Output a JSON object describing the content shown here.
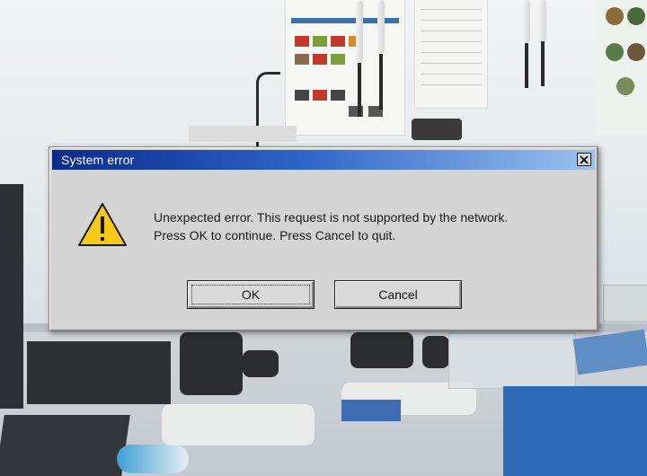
{
  "dialog": {
    "title": "System error",
    "close_icon": "close-icon",
    "icon": "warning-triangle-icon",
    "message_line1": "Unexpected error. This request is not supported by the network.",
    "message_line2": "Press OK to continue. Press Cancel to quit.",
    "ok_label": "OK",
    "cancel_label": "Cancel"
  },
  "colors": {
    "titlebar_start": "#0a2a8a",
    "titlebar_end": "#9bc2ee",
    "dialog_bg": "#d4d4d4",
    "warning_yellow": "#f6c81c"
  }
}
